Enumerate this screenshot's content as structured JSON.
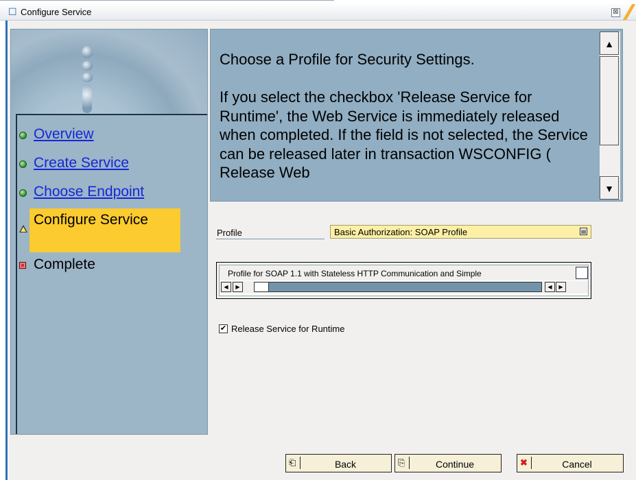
{
  "window": {
    "title": "Configure Service",
    "icon": "edit-icon",
    "close_glyph": "⊠"
  },
  "steps": [
    {
      "label": "Overview",
      "status": "completed",
      "link": true
    },
    {
      "label": "Create Service",
      "status": "completed",
      "link": true
    },
    {
      "label": "Choose Endpoint",
      "status": "completed",
      "link": true
    },
    {
      "label": "Configure Service",
      "status": "current",
      "link": false
    },
    {
      "label": "Complete",
      "status": "pending",
      "link": false
    }
  ],
  "help": {
    "heading": "Choose a Profile for Security Settings.",
    "body": "If you select the checkbox 'Release Service for Runtime', the Web Service is immediately released when completed. If the field is not selected, the Service can be released later in transaction WSCONFIG ( Release Web"
  },
  "profile": {
    "label": "Profile",
    "value": "Basic Authorization: SOAP Profile"
  },
  "profile_list": {
    "row_text": "Profile for SOAP 1.1 with Stateless HTTP Communication and Simple"
  },
  "release": {
    "label": "Release Service for Runtime",
    "checked": true
  },
  "buttons": {
    "back": "Back",
    "continue": "Continue",
    "cancel": "Cancel"
  },
  "colors": {
    "panel_blue": "#9db6c8",
    "highlight": "#fccb2f",
    "link": "#1427d6",
    "dropdown_bg": "#fbf0a5"
  }
}
